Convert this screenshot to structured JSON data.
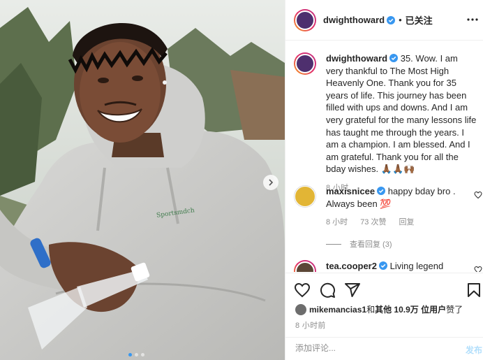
{
  "colors": {
    "accent": "#3897f0",
    "muted": "#8e8e8e",
    "text": "#262626",
    "post_button": "#b2dffc",
    "border": "#efefef"
  },
  "photo": {
    "shirt_text": "Sportsmdch",
    "carousel_next_icon": "chevron-right-icon",
    "carousel": {
      "count": 3,
      "active_index": 0
    }
  },
  "header": {
    "username": "dwighthoward",
    "separator": "•",
    "follow_label": "已关注",
    "more_icon": "more-horizontal-icon",
    "verified_icon": "verified-badge-icon"
  },
  "caption": {
    "username": "dwighthoward",
    "text": " 35. Wow. I am very thankful to The Most High Heavenly One. Thank you for 35 years of life. This journey has been filled with ups and downs. And I am very grateful for the many lessons life has taught me through the years. I am a champion. I am blessed. And I am grateful. Thank you for all the bday wishes. 🙏🏾🙏🏾🙌🏾",
    "time": "8 小时"
  },
  "comments": [
    {
      "username": "maxisnicee",
      "text": " happy bday bro . Always been 💯",
      "time": "8 小时",
      "likes": "73 次赞",
      "reply": "回复",
      "heart_icon": "heart-outline-icon"
    },
    {
      "username": "tea.cooper2",
      "text": " Living legend",
      "heart_icon": "heart-outline-icon"
    }
  ],
  "view_replies": "查看回复 (3)",
  "actions": {
    "like_icon": "heart-icon",
    "comment_icon": "comment-icon",
    "share_icon": "paper-plane-icon",
    "save_icon": "bookmark-icon"
  },
  "likes_line": {
    "user": "mikemancias1",
    "and": " 和 ",
    "others": "其他 10.9万 位用户",
    "suffix": " 赞了"
  },
  "post_time": "8 小时前",
  "add_comment": {
    "placeholder": "添加评论...",
    "post_label": "发布"
  }
}
